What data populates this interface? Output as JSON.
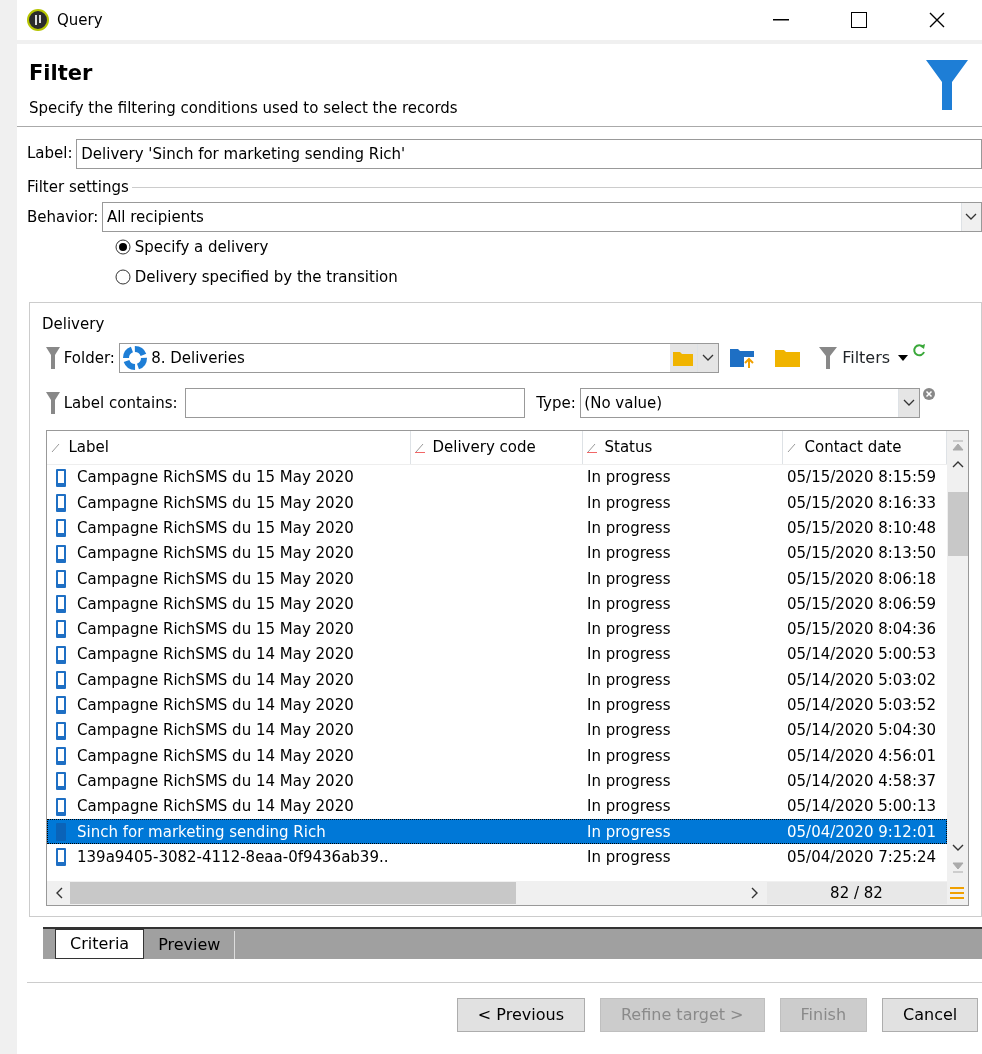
{
  "window": {
    "title": "Query"
  },
  "header": {
    "title": "Filter",
    "subtitle": "Specify the filtering conditions used to select the records"
  },
  "label_field": {
    "label": "Label:",
    "value": "Delivery 'Sinch for marketing sending Rich'"
  },
  "filter_settings": {
    "title": "Filter settings",
    "behavior_label": "Behavior:",
    "behavior_value": "All recipients",
    "options": [
      {
        "label": "Specify a delivery",
        "selected": true
      },
      {
        "label": "Delivery specified by the transition",
        "selected": false
      }
    ]
  },
  "delivery": {
    "title": "Delivery",
    "folder_label": "Folder:",
    "folder_value": "8. Deliveries",
    "filters_label": "Filters",
    "label_contains": "Label contains:",
    "type_label": "Type:",
    "type_value": "(No value)",
    "columns": [
      "Label",
      "Delivery code",
      "Status",
      "Contact date"
    ],
    "rows": [
      {
        "label": "Campagne RichSMS du 15 May 2020",
        "status": "In progress",
        "date": "05/15/2020 8:15:59",
        "selected": false
      },
      {
        "label": "Campagne RichSMS du 15 May 2020",
        "status": "In progress",
        "date": "05/15/2020 8:16:33",
        "selected": false
      },
      {
        "label": "Campagne RichSMS du 15 May 2020",
        "status": "In progress",
        "date": "05/15/2020 8:10:48",
        "selected": false
      },
      {
        "label": "Campagne RichSMS du 15 May 2020",
        "status": "In progress",
        "date": "05/15/2020 8:13:50",
        "selected": false
      },
      {
        "label": "Campagne RichSMS du 15 May 2020",
        "status": "In progress",
        "date": "05/15/2020 8:06:18",
        "selected": false
      },
      {
        "label": "Campagne RichSMS du 15 May 2020",
        "status": "In progress",
        "date": "05/15/2020 8:06:59",
        "selected": false
      },
      {
        "label": "Campagne RichSMS du 15 May 2020",
        "status": "In progress",
        "date": "05/15/2020 8:04:36",
        "selected": false
      },
      {
        "label": "Campagne RichSMS du 14 May 2020",
        "status": "In progress",
        "date": "05/14/2020 5:00:53",
        "selected": false
      },
      {
        "label": "Campagne RichSMS du 14 May 2020",
        "status": "In progress",
        "date": "05/14/2020 5:03:02",
        "selected": false
      },
      {
        "label": "Campagne RichSMS du 14 May 2020",
        "status": "In progress",
        "date": "05/14/2020 5:03:52",
        "selected": false
      },
      {
        "label": "Campagne RichSMS du 14 May 2020",
        "status": "In progress",
        "date": "05/14/2020 5:04:30",
        "selected": false
      },
      {
        "label": "Campagne RichSMS du 14 May 2020",
        "status": "In progress",
        "date": "05/14/2020 4:56:01",
        "selected": false
      },
      {
        "label": "Campagne RichSMS du 14 May 2020",
        "status": "In progress",
        "date": "05/14/2020 4:58:37",
        "selected": false
      },
      {
        "label": "Campagne RichSMS du 14 May 2020",
        "status": "In progress",
        "date": "05/14/2020 5:00:13",
        "selected": false
      },
      {
        "label": "Sinch for marketing sending Rich",
        "status": "In progress",
        "date": "05/04/2020 9:12:01",
        "selected": true
      },
      {
        "label": "139a9405-3082-4112-8eaa-0f9436ab39..",
        "status": "In progress",
        "date": "05/04/2020 7:25:24",
        "selected": false
      }
    ],
    "count": "82 / 82"
  },
  "tabs": [
    {
      "label": "Criteria",
      "selected": true
    },
    {
      "label": "Preview",
      "selected": false
    }
  ],
  "buttons": [
    {
      "label": "< Previous",
      "disabled": false
    },
    {
      "label": "Refine target >",
      "disabled": true
    },
    {
      "label": "Finish",
      "disabled": true
    },
    {
      "label": "Cancel",
      "disabled": false
    }
  ]
}
